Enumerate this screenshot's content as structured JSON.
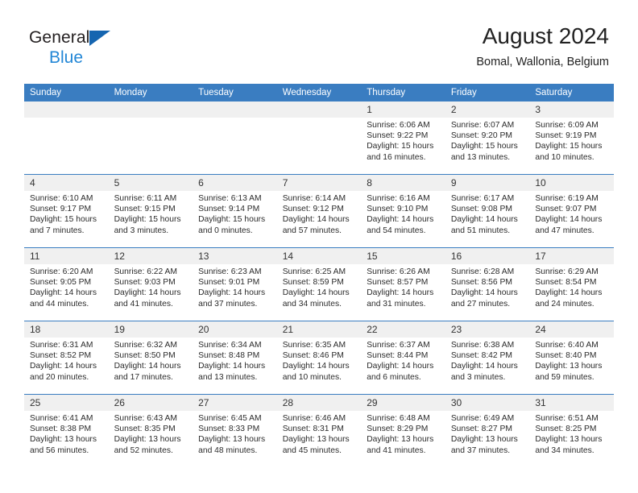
{
  "brand": {
    "line1": "General",
    "line2": "Blue",
    "triangle_color": "#1565b0",
    "line2_color": "#2387d6"
  },
  "header": {
    "title": "August 2024",
    "subtitle": "Bomal, Wallonia, Belgium"
  },
  "theme": {
    "header_blue": "#3a7dc1",
    "daynum_band": "#f0f0f0",
    "text": "#2b2b2b"
  },
  "calendar": {
    "weekday_headers": [
      "Sunday",
      "Monday",
      "Tuesday",
      "Wednesday",
      "Thursday",
      "Friday",
      "Saturday"
    ],
    "labels": {
      "sunrise": "Sunrise:",
      "sunset": "Sunset:",
      "daylight": "Daylight:"
    },
    "weeks": [
      [
        {
          "day": "",
          "sunrise": "",
          "sunset": "",
          "daylight1": "",
          "daylight2": "",
          "empty": true
        },
        {
          "day": "",
          "sunrise": "",
          "sunset": "",
          "daylight1": "",
          "daylight2": "",
          "empty": true
        },
        {
          "day": "",
          "sunrise": "",
          "sunset": "",
          "daylight1": "",
          "daylight2": "",
          "empty": true
        },
        {
          "day": "",
          "sunrise": "",
          "sunset": "",
          "daylight1": "",
          "daylight2": "",
          "empty": true
        },
        {
          "day": "1",
          "sunrise": "Sunrise: 6:06 AM",
          "sunset": "Sunset: 9:22 PM",
          "daylight1": "Daylight: 15 hours",
          "daylight2": "and 16 minutes.",
          "empty": false
        },
        {
          "day": "2",
          "sunrise": "Sunrise: 6:07 AM",
          "sunset": "Sunset: 9:20 PM",
          "daylight1": "Daylight: 15 hours",
          "daylight2": "and 13 minutes.",
          "empty": false
        },
        {
          "day": "3",
          "sunrise": "Sunrise: 6:09 AM",
          "sunset": "Sunset: 9:19 PM",
          "daylight1": "Daylight: 15 hours",
          "daylight2": "and 10 minutes.",
          "empty": false
        }
      ],
      [
        {
          "day": "4",
          "sunrise": "Sunrise: 6:10 AM",
          "sunset": "Sunset: 9:17 PM",
          "daylight1": "Daylight: 15 hours",
          "daylight2": "and 7 minutes.",
          "empty": false
        },
        {
          "day": "5",
          "sunrise": "Sunrise: 6:11 AM",
          "sunset": "Sunset: 9:15 PM",
          "daylight1": "Daylight: 15 hours",
          "daylight2": "and 3 minutes.",
          "empty": false
        },
        {
          "day": "6",
          "sunrise": "Sunrise: 6:13 AM",
          "sunset": "Sunset: 9:14 PM",
          "daylight1": "Daylight: 15 hours",
          "daylight2": "and 0 minutes.",
          "empty": false
        },
        {
          "day": "7",
          "sunrise": "Sunrise: 6:14 AM",
          "sunset": "Sunset: 9:12 PM",
          "daylight1": "Daylight: 14 hours",
          "daylight2": "and 57 minutes.",
          "empty": false
        },
        {
          "day": "8",
          "sunrise": "Sunrise: 6:16 AM",
          "sunset": "Sunset: 9:10 PM",
          "daylight1": "Daylight: 14 hours",
          "daylight2": "and 54 minutes.",
          "empty": false
        },
        {
          "day": "9",
          "sunrise": "Sunrise: 6:17 AM",
          "sunset": "Sunset: 9:08 PM",
          "daylight1": "Daylight: 14 hours",
          "daylight2": "and 51 minutes.",
          "empty": false
        },
        {
          "day": "10",
          "sunrise": "Sunrise: 6:19 AM",
          "sunset": "Sunset: 9:07 PM",
          "daylight1": "Daylight: 14 hours",
          "daylight2": "and 47 minutes.",
          "empty": false
        }
      ],
      [
        {
          "day": "11",
          "sunrise": "Sunrise: 6:20 AM",
          "sunset": "Sunset: 9:05 PM",
          "daylight1": "Daylight: 14 hours",
          "daylight2": "and 44 minutes.",
          "empty": false
        },
        {
          "day": "12",
          "sunrise": "Sunrise: 6:22 AM",
          "sunset": "Sunset: 9:03 PM",
          "daylight1": "Daylight: 14 hours",
          "daylight2": "and 41 minutes.",
          "empty": false
        },
        {
          "day": "13",
          "sunrise": "Sunrise: 6:23 AM",
          "sunset": "Sunset: 9:01 PM",
          "daylight1": "Daylight: 14 hours",
          "daylight2": "and 37 minutes.",
          "empty": false
        },
        {
          "day": "14",
          "sunrise": "Sunrise: 6:25 AM",
          "sunset": "Sunset: 8:59 PM",
          "daylight1": "Daylight: 14 hours",
          "daylight2": "and 34 minutes.",
          "empty": false
        },
        {
          "day": "15",
          "sunrise": "Sunrise: 6:26 AM",
          "sunset": "Sunset: 8:57 PM",
          "daylight1": "Daylight: 14 hours",
          "daylight2": "and 31 minutes.",
          "empty": false
        },
        {
          "day": "16",
          "sunrise": "Sunrise: 6:28 AM",
          "sunset": "Sunset: 8:56 PM",
          "daylight1": "Daylight: 14 hours",
          "daylight2": "and 27 minutes.",
          "empty": false
        },
        {
          "day": "17",
          "sunrise": "Sunrise: 6:29 AM",
          "sunset": "Sunset: 8:54 PM",
          "daylight1": "Daylight: 14 hours",
          "daylight2": "and 24 minutes.",
          "empty": false
        }
      ],
      [
        {
          "day": "18",
          "sunrise": "Sunrise: 6:31 AM",
          "sunset": "Sunset: 8:52 PM",
          "daylight1": "Daylight: 14 hours",
          "daylight2": "and 20 minutes.",
          "empty": false
        },
        {
          "day": "19",
          "sunrise": "Sunrise: 6:32 AM",
          "sunset": "Sunset: 8:50 PM",
          "daylight1": "Daylight: 14 hours",
          "daylight2": "and 17 minutes.",
          "empty": false
        },
        {
          "day": "20",
          "sunrise": "Sunrise: 6:34 AM",
          "sunset": "Sunset: 8:48 PM",
          "daylight1": "Daylight: 14 hours",
          "daylight2": "and 13 minutes.",
          "empty": false
        },
        {
          "day": "21",
          "sunrise": "Sunrise: 6:35 AM",
          "sunset": "Sunset: 8:46 PM",
          "daylight1": "Daylight: 14 hours",
          "daylight2": "and 10 minutes.",
          "empty": false
        },
        {
          "day": "22",
          "sunrise": "Sunrise: 6:37 AM",
          "sunset": "Sunset: 8:44 PM",
          "daylight1": "Daylight: 14 hours",
          "daylight2": "and 6 minutes.",
          "empty": false
        },
        {
          "day": "23",
          "sunrise": "Sunrise: 6:38 AM",
          "sunset": "Sunset: 8:42 PM",
          "daylight1": "Daylight: 14 hours",
          "daylight2": "and 3 minutes.",
          "empty": false
        },
        {
          "day": "24",
          "sunrise": "Sunrise: 6:40 AM",
          "sunset": "Sunset: 8:40 PM",
          "daylight1": "Daylight: 13 hours",
          "daylight2": "and 59 minutes.",
          "empty": false
        }
      ],
      [
        {
          "day": "25",
          "sunrise": "Sunrise: 6:41 AM",
          "sunset": "Sunset: 8:38 PM",
          "daylight1": "Daylight: 13 hours",
          "daylight2": "and 56 minutes.",
          "empty": false
        },
        {
          "day": "26",
          "sunrise": "Sunrise: 6:43 AM",
          "sunset": "Sunset: 8:35 PM",
          "daylight1": "Daylight: 13 hours",
          "daylight2": "and 52 minutes.",
          "empty": false
        },
        {
          "day": "27",
          "sunrise": "Sunrise: 6:45 AM",
          "sunset": "Sunset: 8:33 PM",
          "daylight1": "Daylight: 13 hours",
          "daylight2": "and 48 minutes.",
          "empty": false
        },
        {
          "day": "28",
          "sunrise": "Sunrise: 6:46 AM",
          "sunset": "Sunset: 8:31 PM",
          "daylight1": "Daylight: 13 hours",
          "daylight2": "and 45 minutes.",
          "empty": false
        },
        {
          "day": "29",
          "sunrise": "Sunrise: 6:48 AM",
          "sunset": "Sunset: 8:29 PM",
          "daylight1": "Daylight: 13 hours",
          "daylight2": "and 41 minutes.",
          "empty": false
        },
        {
          "day": "30",
          "sunrise": "Sunrise: 6:49 AM",
          "sunset": "Sunset: 8:27 PM",
          "daylight1": "Daylight: 13 hours",
          "daylight2": "and 37 minutes.",
          "empty": false
        },
        {
          "day": "31",
          "sunrise": "Sunrise: 6:51 AM",
          "sunset": "Sunset: 8:25 PM",
          "daylight1": "Daylight: 13 hours",
          "daylight2": "and 34 minutes.",
          "empty": false
        }
      ]
    ]
  }
}
